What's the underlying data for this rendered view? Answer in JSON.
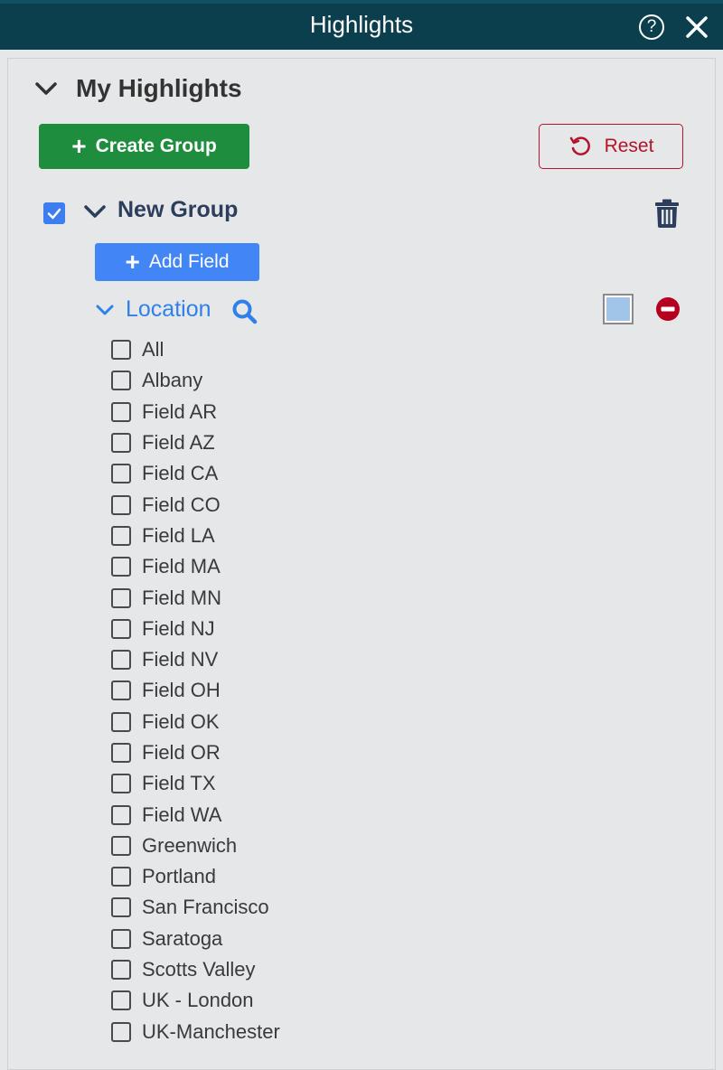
{
  "window": {
    "title": "Highlights",
    "help_icon": "help-circle-icon",
    "close_icon": "close-icon"
  },
  "section": {
    "title": "My Highlights",
    "expanded": true
  },
  "toolbar": {
    "create_group_label": "Create Group",
    "reset_label": "Reset"
  },
  "group": {
    "name": "New Group",
    "checked": true,
    "expanded": true,
    "add_field_label": "Add Field",
    "field": {
      "name": "Location",
      "expanded": true,
      "highlight_color": "#a1c5e8",
      "options": [
        {
          "label": "All",
          "checked": false
        },
        {
          "label": "Albany",
          "checked": false
        },
        {
          "label": "Field AR",
          "checked": false
        },
        {
          "label": "Field AZ",
          "checked": false
        },
        {
          "label": "Field CA",
          "checked": false
        },
        {
          "label": "Field CO",
          "checked": false
        },
        {
          "label": "Field LA",
          "checked": false
        },
        {
          "label": "Field MA",
          "checked": false
        },
        {
          "label": "Field MN",
          "checked": false
        },
        {
          "label": "Field NJ",
          "checked": false
        },
        {
          "label": "Field NV",
          "checked": false
        },
        {
          "label": "Field OH",
          "checked": false
        },
        {
          "label": "Field OK",
          "checked": false
        },
        {
          "label": "Field OR",
          "checked": false
        },
        {
          "label": "Field TX",
          "checked": false
        },
        {
          "label": "Field WA",
          "checked": false
        },
        {
          "label": "Greenwich",
          "checked": false
        },
        {
          "label": "Portland",
          "checked": false
        },
        {
          "label": "San Francisco",
          "checked": false
        },
        {
          "label": "Saratoga",
          "checked": false
        },
        {
          "label": "Scotts Valley",
          "checked": false
        },
        {
          "label": "UK - London",
          "checked": false
        },
        {
          "label": "UK-Manchester",
          "checked": false
        }
      ]
    }
  },
  "colors": {
    "titlebar": "#0c3f4d",
    "create_button": "#1e8e3e",
    "reset_accent": "#b5132b",
    "add_field_button": "#4285f4",
    "field_link": "#2f80e8",
    "group_name": "#2d3d5c"
  }
}
